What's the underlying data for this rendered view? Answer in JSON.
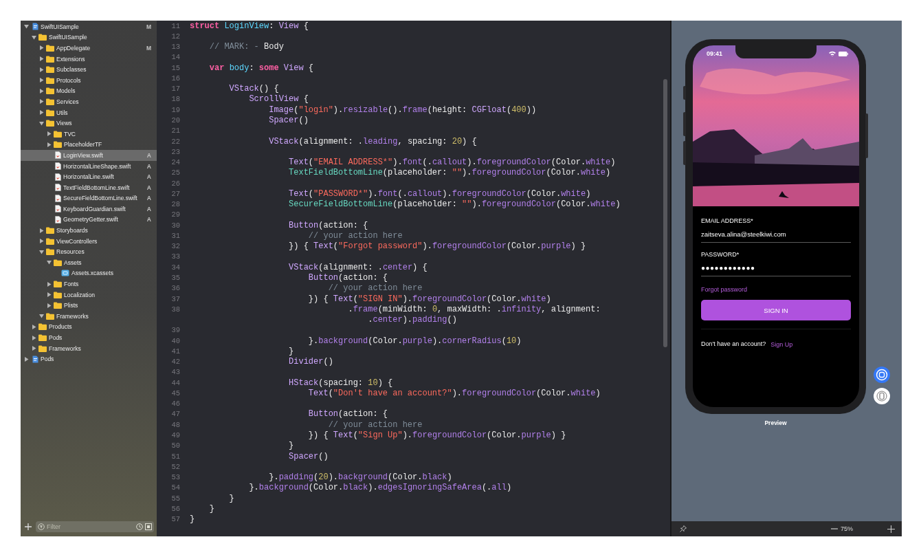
{
  "navigator": {
    "items": [
      {
        "name": "SwiftUISample",
        "kind": "project",
        "expanded": true,
        "selected": false,
        "badge": "M",
        "children": [
          {
            "name": "SwiftUISample",
            "kind": "folder",
            "expanded": true,
            "selected": false,
            "children": [
              {
                "name": "AppDelegate",
                "kind": "folder",
                "expanded": false,
                "selected": false,
                "badge": "M"
              },
              {
                "name": "Extensions",
                "kind": "folder",
                "expanded": false,
                "selected": false
              },
              {
                "name": "Subclasses",
                "kind": "folder",
                "expanded": false,
                "selected": false
              },
              {
                "name": "Protocols",
                "kind": "folder",
                "expanded": false,
                "selected": false
              },
              {
                "name": "Models",
                "kind": "folder",
                "expanded": false,
                "selected": false
              },
              {
                "name": "Services",
                "kind": "folder",
                "expanded": false,
                "selected": false
              },
              {
                "name": "Utils",
                "kind": "folder",
                "expanded": false,
                "selected": false
              },
              {
                "name": "Views",
                "kind": "folder",
                "expanded": true,
                "selected": false,
                "children": [
                  {
                    "name": "TVC",
                    "kind": "folder",
                    "expanded": false,
                    "selected": false
                  },
                  {
                    "name": "PlaceholderTF",
                    "kind": "folder",
                    "expanded": false,
                    "selected": false
                  },
                  {
                    "name": "LoginView.swift",
                    "kind": "file",
                    "selected": true,
                    "badge": "A"
                  },
                  {
                    "name": "HorizontalLineShape.swift",
                    "kind": "file",
                    "selected": false,
                    "badge": "A"
                  },
                  {
                    "name": "HorizontalLine.swift",
                    "kind": "file",
                    "selected": false,
                    "badge": "A"
                  },
                  {
                    "name": "TextFieldBottomLine.swift",
                    "kind": "file",
                    "selected": false,
                    "badge": "A"
                  },
                  {
                    "name": "SecureFieldBottomLine.swift",
                    "kind": "file",
                    "selected": false,
                    "badge": "A"
                  },
                  {
                    "name": "KeyboardGuardian.swift",
                    "kind": "file",
                    "selected": false,
                    "badge": "A"
                  },
                  {
                    "name": "GeometryGetter.swift",
                    "kind": "file",
                    "selected": false,
                    "badge": "A"
                  }
                ]
              },
              {
                "name": "Storyboards",
                "kind": "folder",
                "expanded": false,
                "selected": false
              },
              {
                "name": "ViewControllers",
                "kind": "folder",
                "expanded": false,
                "selected": false
              },
              {
                "name": "Resources",
                "kind": "folder",
                "expanded": true,
                "selected": false,
                "children": [
                  {
                    "name": "Assets",
                    "kind": "folder",
                    "expanded": true,
                    "selected": false,
                    "children": [
                      {
                        "name": "Assets.xcassets",
                        "kind": "assets",
                        "selected": false
                      }
                    ]
                  },
                  {
                    "name": "Fonts",
                    "kind": "folder",
                    "expanded": false,
                    "selected": false
                  },
                  {
                    "name": "Localization",
                    "kind": "folder",
                    "expanded": false,
                    "selected": false
                  },
                  {
                    "name": "Plists",
                    "kind": "folder",
                    "expanded": false,
                    "selected": false
                  }
                ]
              },
              {
                "name": "Frameworks",
                "kind": "folder",
                "expanded": true,
                "selected": false
              }
            ]
          },
          {
            "name": "Products",
            "kind": "folder",
            "expanded": false,
            "selected": false
          },
          {
            "name": "Pods",
            "kind": "folder",
            "expanded": false,
            "selected": false
          },
          {
            "name": "Frameworks",
            "kind": "folder",
            "expanded": false,
            "selected": false
          }
        ]
      },
      {
        "name": "Pods",
        "kind": "project",
        "expanded": false,
        "selected": false
      }
    ],
    "filter": {
      "placeholder": "Filter"
    }
  },
  "editor": {
    "lines": [
      {
        "number": "11",
        "tokens": [
          {
            "kind": "kw",
            "text": "struct "
          },
          {
            "kind": "decl",
            "text": "LoginView"
          },
          {
            "kind": "plain",
            "text": ": "
          },
          {
            "kind": "lib",
            "text": "View"
          },
          {
            "kind": "plain",
            "text": " {"
          }
        ]
      },
      {
        "number": "12"
      },
      {
        "number": "13",
        "tokens": [
          {
            "kind": "cm",
            "text": "    // MARK: - "
          },
          {
            "kind": "plain",
            "text": "Body"
          }
        ]
      },
      {
        "number": "14"
      },
      {
        "number": "15",
        "tokens": [
          {
            "kind": "kw",
            "text": "    var "
          },
          {
            "kind": "decl",
            "text": "body"
          },
          {
            "kind": "plain",
            "text": ": "
          },
          {
            "kind": "kw",
            "text": "some "
          },
          {
            "kind": "lib",
            "text": "View"
          },
          {
            "kind": "plain",
            "text": " {"
          }
        ]
      },
      {
        "number": "16"
      },
      {
        "number": "17",
        "tokens": [
          {
            "kind": "lib",
            "text": "        VStack"
          },
          {
            "kind": "plain",
            "text": "() {"
          }
        ]
      },
      {
        "number": "18",
        "tokens": [
          {
            "kind": "lib",
            "text": "            ScrollView"
          },
          {
            "kind": "plain",
            "text": " {"
          }
        ]
      },
      {
        "number": "19",
        "tokens": [
          {
            "kind": "lib",
            "text": "                Image"
          },
          {
            "kind": "plain",
            "text": "("
          },
          {
            "kind": "str",
            "text": "\"login\""
          },
          {
            "kind": "plain",
            "text": ")."
          },
          {
            "kind": "fn",
            "text": "resizable"
          },
          {
            "kind": "plain",
            "text": "()."
          },
          {
            "kind": "fn",
            "text": "frame"
          },
          {
            "kind": "plain",
            "text": "(height: "
          },
          {
            "kind": "lib",
            "text": "CGFloat"
          },
          {
            "kind": "plain",
            "text": "("
          },
          {
            "kind": "num",
            "text": "400"
          },
          {
            "kind": "plain",
            "text": "))"
          }
        ]
      },
      {
        "number": "20",
        "tokens": [
          {
            "kind": "lib",
            "text": "                Spacer"
          },
          {
            "kind": "plain",
            "text": "()"
          }
        ]
      },
      {
        "number": "21"
      },
      {
        "number": "22",
        "tokens": [
          {
            "kind": "lib",
            "text": "                VStack"
          },
          {
            "kind": "plain",
            "text": "(alignment: ."
          },
          {
            "kind": "fn",
            "text": "leading"
          },
          {
            "kind": "plain",
            "text": ", spacing: "
          },
          {
            "kind": "num",
            "text": "20"
          },
          {
            "kind": "plain",
            "text": ") {"
          }
        ]
      },
      {
        "number": "23"
      },
      {
        "number": "24",
        "tokens": [
          {
            "kind": "lib",
            "text": "                    Text"
          },
          {
            "kind": "plain",
            "text": "("
          },
          {
            "kind": "str",
            "text": "\"EMAIL ADDRESS*\""
          },
          {
            "kind": "plain",
            "text": ")."
          },
          {
            "kind": "fn",
            "text": "font"
          },
          {
            "kind": "plain",
            "text": "(."
          },
          {
            "kind": "fn",
            "text": "callout"
          },
          {
            "kind": "plain",
            "text": ")."
          },
          {
            "kind": "fn",
            "text": "foregroundColor"
          },
          {
            "kind": "plain",
            "text": "(Color."
          },
          {
            "kind": "fn",
            "text": "white"
          },
          {
            "kind": "plain",
            "text": ")"
          }
        ]
      },
      {
        "number": "25",
        "tokens": [
          {
            "kind": "type",
            "text": "                    TextFieldBottomLine"
          },
          {
            "kind": "plain",
            "text": "(placeholder: "
          },
          {
            "kind": "str",
            "text": "\"\""
          },
          {
            "kind": "plain",
            "text": ")."
          },
          {
            "kind": "fn",
            "text": "foregroundColor"
          },
          {
            "kind": "plain",
            "text": "(Color."
          },
          {
            "kind": "fn",
            "text": "white"
          },
          {
            "kind": "plain",
            "text": ")"
          }
        ]
      },
      {
        "number": "26"
      },
      {
        "number": "27",
        "tokens": [
          {
            "kind": "lib",
            "text": "                    Text"
          },
          {
            "kind": "plain",
            "text": "("
          },
          {
            "kind": "str",
            "text": "\"PASSWORD*\""
          },
          {
            "kind": "plain",
            "text": ")."
          },
          {
            "kind": "fn",
            "text": "font"
          },
          {
            "kind": "plain",
            "text": "(."
          },
          {
            "kind": "fn",
            "text": "callout"
          },
          {
            "kind": "plain",
            "text": ")."
          },
          {
            "kind": "fn",
            "text": "foregroundColor"
          },
          {
            "kind": "plain",
            "text": "(Color."
          },
          {
            "kind": "fn",
            "text": "white"
          },
          {
            "kind": "plain",
            "text": ")"
          }
        ]
      },
      {
        "number": "28",
        "tokens": [
          {
            "kind": "type",
            "text": "                    SecureFieldBottomLine"
          },
          {
            "kind": "plain",
            "text": "(placeholder: "
          },
          {
            "kind": "str",
            "text": "\"\""
          },
          {
            "kind": "plain",
            "text": ")."
          },
          {
            "kind": "fn",
            "text": "foregroundColor"
          },
          {
            "kind": "plain",
            "text": "(Color."
          },
          {
            "kind": "fn",
            "text": "white"
          },
          {
            "kind": "plain",
            "text": ")"
          }
        ]
      },
      {
        "number": "29"
      },
      {
        "number": "30",
        "tokens": [
          {
            "kind": "lib",
            "text": "                    Button"
          },
          {
            "kind": "plain",
            "text": "(action: {"
          }
        ]
      },
      {
        "number": "31",
        "tokens": [
          {
            "kind": "cm",
            "text": "                        // your action here"
          }
        ]
      },
      {
        "number": "32",
        "tokens": [
          {
            "kind": "plain",
            "text": "                    }) { "
          },
          {
            "kind": "lib",
            "text": "Text"
          },
          {
            "kind": "plain",
            "text": "("
          },
          {
            "kind": "str",
            "text": "\"Forgot password\""
          },
          {
            "kind": "plain",
            "text": ")."
          },
          {
            "kind": "fn",
            "text": "foregroundColor"
          },
          {
            "kind": "plain",
            "text": "(Color."
          },
          {
            "kind": "fn",
            "text": "purple"
          },
          {
            "kind": "plain",
            "text": ") }"
          }
        ]
      },
      {
        "number": "33"
      },
      {
        "number": "34",
        "tokens": [
          {
            "kind": "lib",
            "text": "                    VStack"
          },
          {
            "kind": "plain",
            "text": "(alignment: ."
          },
          {
            "kind": "fn",
            "text": "center"
          },
          {
            "kind": "plain",
            "text": ") {"
          }
        ]
      },
      {
        "number": "35",
        "tokens": [
          {
            "kind": "lib",
            "text": "                        Button"
          },
          {
            "kind": "plain",
            "text": "(action: {"
          }
        ]
      },
      {
        "number": "36",
        "tokens": [
          {
            "kind": "cm",
            "text": "                            // your action here"
          }
        ]
      },
      {
        "number": "37",
        "tokens": [
          {
            "kind": "plain",
            "text": "                        }) { "
          },
          {
            "kind": "lib",
            "text": "Text"
          },
          {
            "kind": "plain",
            "text": "("
          },
          {
            "kind": "str",
            "text": "\"SIGN IN\""
          },
          {
            "kind": "plain",
            "text": ")."
          },
          {
            "kind": "fn",
            "text": "foregroundColor"
          },
          {
            "kind": "plain",
            "text": "(Color."
          },
          {
            "kind": "fn",
            "text": "white"
          },
          {
            "kind": "plain",
            "text": ")"
          }
        ]
      },
      {
        "number": "38",
        "tokens": [
          {
            "kind": "plain",
            "text": "                                ."
          },
          {
            "kind": "fn",
            "text": "frame"
          },
          {
            "kind": "plain",
            "text": "(minWidth: "
          },
          {
            "kind": "num",
            "text": "0"
          },
          {
            "kind": "plain",
            "text": ", maxWidth: ."
          },
          {
            "kind": "fn",
            "text": "infinity"
          },
          {
            "kind": "plain",
            "text": ", alignment:"
          }
        ]
      },
      {
        "tokens": [
          {
            "kind": "plain",
            "text": "                                    ."
          },
          {
            "kind": "fn",
            "text": "center"
          },
          {
            "kind": "plain",
            "text": ")."
          },
          {
            "kind": "fn",
            "text": "padding"
          },
          {
            "kind": "plain",
            "text": "()"
          }
        ]
      },
      {
        "number": "39"
      },
      {
        "number": "40",
        "tokens": [
          {
            "kind": "plain",
            "text": "                        }."
          },
          {
            "kind": "fn",
            "text": "background"
          },
          {
            "kind": "plain",
            "text": "(Color."
          },
          {
            "kind": "fn",
            "text": "purple"
          },
          {
            "kind": "plain",
            "text": ")."
          },
          {
            "kind": "fn",
            "text": "cornerRadius"
          },
          {
            "kind": "plain",
            "text": "("
          },
          {
            "kind": "num",
            "text": "10"
          },
          {
            "kind": "plain",
            "text": ")"
          }
        ]
      },
      {
        "number": "41",
        "tokens": [
          {
            "kind": "plain",
            "text": "                    }"
          }
        ]
      },
      {
        "number": "42",
        "tokens": [
          {
            "kind": "lib",
            "text": "                    Divider"
          },
          {
            "kind": "plain",
            "text": "()"
          }
        ]
      },
      {
        "number": "43"
      },
      {
        "number": "44",
        "tokens": [
          {
            "kind": "lib",
            "text": "                    HStack"
          },
          {
            "kind": "plain",
            "text": "(spacing: "
          },
          {
            "kind": "num",
            "text": "10"
          },
          {
            "kind": "plain",
            "text": ") {"
          }
        ]
      },
      {
        "number": "45",
        "tokens": [
          {
            "kind": "lib",
            "text": "                        Text"
          },
          {
            "kind": "plain",
            "text": "("
          },
          {
            "kind": "str",
            "text": "\"Don't have an account?\""
          },
          {
            "kind": "plain",
            "text": ")."
          },
          {
            "kind": "fn",
            "text": "foregroundColor"
          },
          {
            "kind": "plain",
            "text": "(Color."
          },
          {
            "kind": "fn",
            "text": "white"
          },
          {
            "kind": "plain",
            "text": ")"
          }
        ]
      },
      {
        "number": "46"
      },
      {
        "number": "47",
        "tokens": [
          {
            "kind": "lib",
            "text": "                        Button"
          },
          {
            "kind": "plain",
            "text": "(action: {"
          }
        ]
      },
      {
        "number": "48",
        "tokens": [
          {
            "kind": "cm",
            "text": "                            // your action here"
          }
        ]
      },
      {
        "number": "49",
        "tokens": [
          {
            "kind": "plain",
            "text": "                        }) { "
          },
          {
            "kind": "lib",
            "text": "Text"
          },
          {
            "kind": "plain",
            "text": "("
          },
          {
            "kind": "str",
            "text": "\"Sign Up\""
          },
          {
            "kind": "plain",
            "text": ")."
          },
          {
            "kind": "fn",
            "text": "foregroundColor"
          },
          {
            "kind": "plain",
            "text": "(Color."
          },
          {
            "kind": "fn",
            "text": "purple"
          },
          {
            "kind": "plain",
            "text": ") }"
          }
        ]
      },
      {
        "number": "50",
        "tokens": [
          {
            "kind": "plain",
            "text": "                    }"
          }
        ]
      },
      {
        "number": "51",
        "tokens": [
          {
            "kind": "lib",
            "text": "                    Spacer"
          },
          {
            "kind": "plain",
            "text": "()"
          }
        ]
      },
      {
        "number": "52"
      },
      {
        "number": "53",
        "tokens": [
          {
            "kind": "plain",
            "text": "                }."
          },
          {
            "kind": "fn",
            "text": "padding"
          },
          {
            "kind": "plain",
            "text": "("
          },
          {
            "kind": "num",
            "text": "20"
          },
          {
            "kind": "plain",
            "text": ")."
          },
          {
            "kind": "fn",
            "text": "background"
          },
          {
            "kind": "plain",
            "text": "(Color."
          },
          {
            "kind": "fn",
            "text": "black"
          },
          {
            "kind": "plain",
            "text": ")"
          }
        ]
      },
      {
        "number": "54",
        "tokens": [
          {
            "kind": "plain",
            "text": "            }."
          },
          {
            "kind": "fn",
            "text": "background"
          },
          {
            "kind": "plain",
            "text": "(Color."
          },
          {
            "kind": "fn",
            "text": "black"
          },
          {
            "kind": "plain",
            "text": ")."
          },
          {
            "kind": "fn",
            "text": "edgesIgnoringSafeArea"
          },
          {
            "kind": "plain",
            "text": "(."
          },
          {
            "kind": "fn",
            "text": "all"
          },
          {
            "kind": "plain",
            "text": ")"
          }
        ]
      },
      {
        "number": "55",
        "tokens": [
          {
            "kind": "plain",
            "text": "        }"
          }
        ]
      },
      {
        "number": "56",
        "tokens": [
          {
            "kind": "plain",
            "text": "    }"
          }
        ]
      },
      {
        "number": "57",
        "tokens": [
          {
            "kind": "plain",
            "text": "}"
          }
        ]
      }
    ]
  },
  "preview": {
    "device": {
      "status_time": "09:41",
      "fields": [
        {
          "kind": "text",
          "label": "EMAIL ADDRESS*",
          "value": "zaitseva.alina@steelkiwi.com"
        },
        {
          "kind": "password",
          "label": "PASSWORD*",
          "value": "●●●●●●●●●●●●"
        }
      ],
      "forgot_link": "Forgot password",
      "sign_in_button": "SIGN IN",
      "signup_prompt": "Don't have an account?",
      "signup_link": "Sign Up"
    },
    "caption": "Preview",
    "zoom": "75%"
  }
}
